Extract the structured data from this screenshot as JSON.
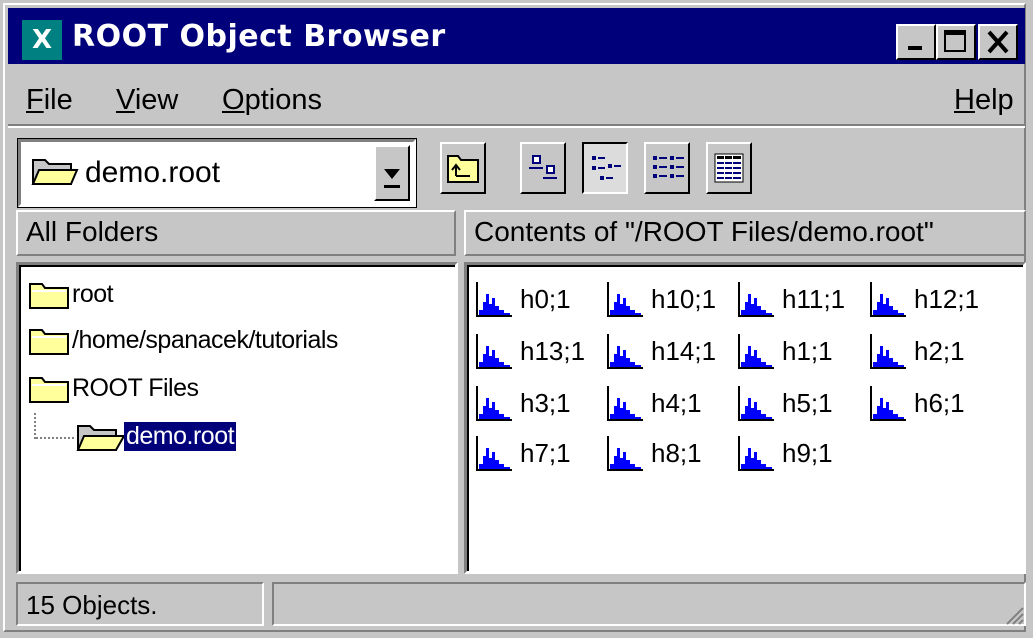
{
  "window": {
    "title": "ROOT Object Browser",
    "icon_glyph": "X",
    "controls": [
      "minimize-icon",
      "maximize-icon",
      "close-icon"
    ]
  },
  "menubar": {
    "file": {
      "accel": "F",
      "rest": "ile"
    },
    "view": {
      "accel": "V",
      "rest": "iew"
    },
    "options": {
      "accel": "O",
      "rest": "ptions"
    },
    "help": {
      "accel": "H",
      "rest": "elp"
    }
  },
  "toolbar": {
    "location_value": "demo.root",
    "buttons": [
      "up-folder-icon",
      "large-icons-icon",
      "small-icons-icon",
      "list-view-icon",
      "details-view-icon"
    ],
    "active_view": "small-icons"
  },
  "left_pane": {
    "header": "All Folders",
    "tree": [
      {
        "label": "root",
        "icon": "folder-icon",
        "selected": false
      },
      {
        "label": "/home/spanacek/tutorials",
        "icon": "folder-icon",
        "selected": false
      },
      {
        "label": "ROOT Files",
        "icon": "folder-icon",
        "selected": false
      },
      {
        "label": "demo.root",
        "icon": "open-folder-icon",
        "selected": true
      }
    ]
  },
  "right_pane": {
    "header": "Contents of \"/ROOT Files/demo.root\"",
    "objects": [
      "h0;1",
      "h10;1",
      "h11;1",
      "h12;1",
      "h13;1",
      "h14;1",
      "h1;1",
      "h2;1",
      "h3;1",
      "h4;1",
      "h5;1",
      "h6;1",
      "h7;1",
      "h8;1",
      "h9;1"
    ]
  },
  "status": {
    "left": "15 Objects.",
    "right": ""
  },
  "colors": {
    "title_bar": "#00007b",
    "window_bg": "#c6c6c6",
    "selection": "#00007b",
    "histogram": "#0000ff",
    "folder": "#ffff9c"
  }
}
